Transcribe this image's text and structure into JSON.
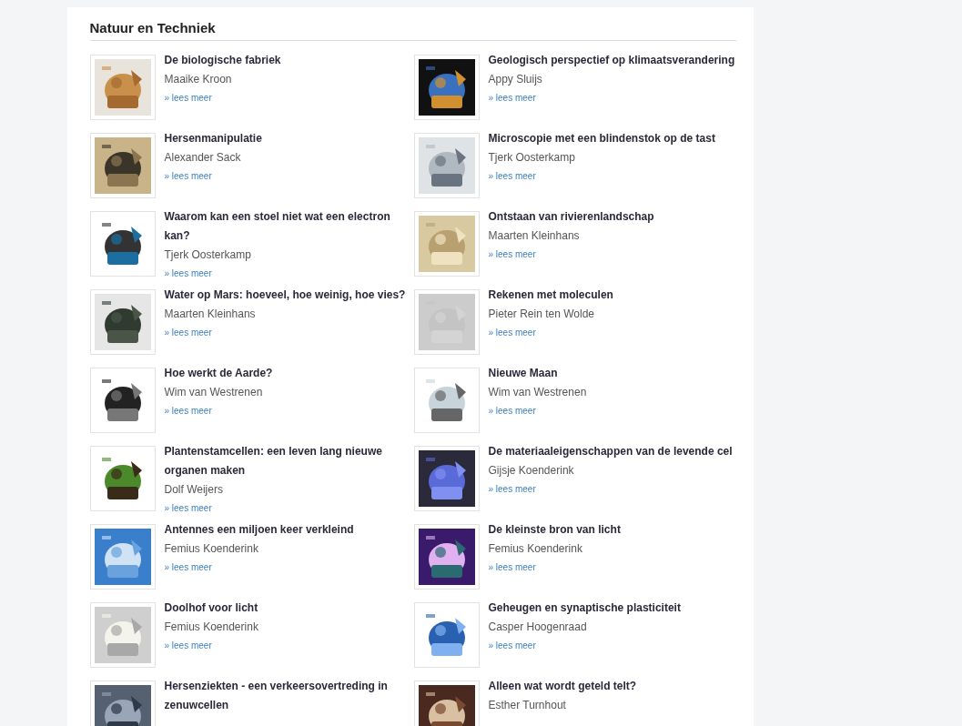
{
  "section": {
    "title": "Natuur en Techniek"
  },
  "columns": [
    [
      {
        "title": "De biologische fabriek",
        "author": "Maaike Kroon",
        "link": "» lees meer"
      },
      {
        "title": "Hersenmanipulatie",
        "author": "Alexander Sack",
        "link": "» lees meer"
      },
      {
        "title": "Waarom kan een stoel niet wat een electron kan?",
        "author": "Tjerk Oosterkamp",
        "link": "» lees meer"
      },
      {
        "title": "Water op Mars: hoeveel, hoe weinig, hoe vies?",
        "author": "Maarten Kleinhans",
        "link": "» lees meer"
      },
      {
        "title": "Hoe werkt de Aarde?",
        "author": "Wim van Westrenen",
        "link": "» lees meer"
      },
      {
        "title": "Plantenstamcellen: een leven lang nieuwe organen maken",
        "author": "Dolf Weijers",
        "link": "» lees meer"
      },
      {
        "title": "Antennes een miljoen keer verkleind",
        "author": "Femius Koenderink",
        "link": "» lees meer"
      },
      {
        "title": "Doolhof voor licht",
        "author": "Femius Koenderink",
        "link": "» lees meer"
      },
      {
        "title": "Hersenziekten - een verkeersovertreding in zenuwcellen"
      }
    ],
    [
      {
        "title": "Geologisch perspectief op klimaatsverandering",
        "author": "Appy Sluijs",
        "link": "» lees meer"
      },
      {
        "title": "Microscopie met een blindenstok op de tast",
        "author": "Tjerk Oosterkamp",
        "link": "» lees meer"
      },
      {
        "title": "Ontstaan van rivierenlandschap",
        "author": "Maarten Kleinhans",
        "link": "» lees meer"
      },
      {
        "title": "Rekenen met moleculen",
        "author": "Pieter Rein ten Wolde",
        "link": "» lees meer"
      },
      {
        "title": "Nieuwe Maan",
        "author": "Wim van Westrenen",
        "link": "» lees meer"
      },
      {
        "title": "De materiaaleigenschappen van de levende cel",
        "author": "Gijsje Koenderink",
        "link": "» lees meer"
      },
      {
        "title": "De kleinste bron van licht",
        "author": "Femius Koenderink",
        "link": "» lees meer"
      },
      {
        "title": "Geheugen en synaptische plasticiteit",
        "author": "Casper Hoogenraad",
        "link": "» lees meer"
      },
      {
        "title": "Alleen wat wordt geteld telt?",
        "author": "Esther Turnhout"
      }
    ]
  ]
}
